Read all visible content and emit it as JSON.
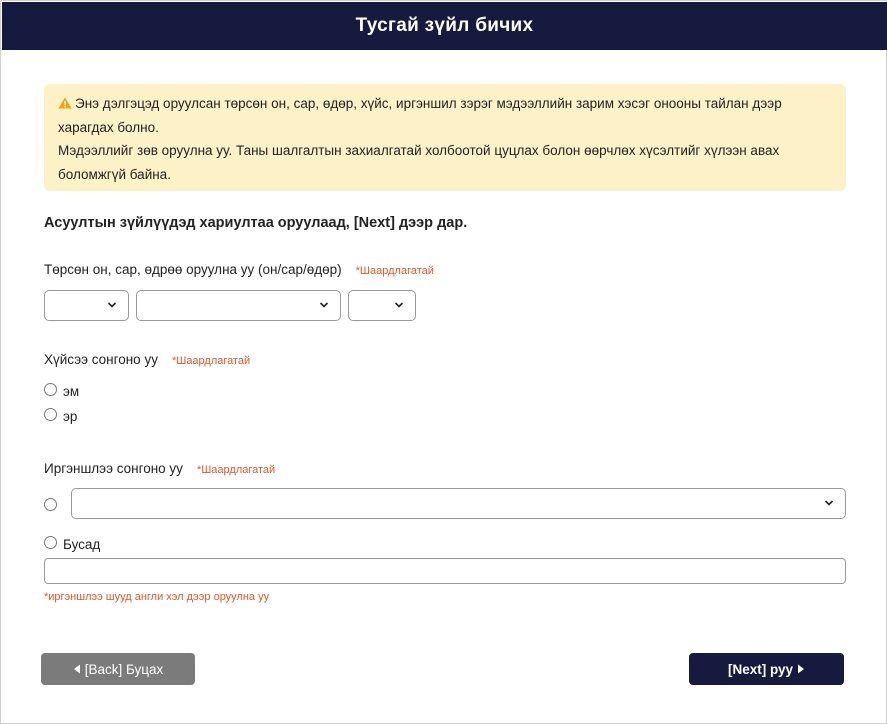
{
  "header": {
    "title": "Тусгай зүйл бичих"
  },
  "notice": {
    "line1": "Энэ дэлгэцэд оруулсан төрсөн он, сар, өдөр, хүйс, иргэншил зэрэг мэдээллийн зарим хэсэг онооны тайлан дээр",
    "line2": "харагдах болно.",
    "line3": "Мэдээллийг зөв оруулна уу. Таны шалгалтын захиалгатай холбоотой цуцлах болон өөрчлөх хүсэлтийг хүлээн авах",
    "line4": "боломжгүй байна.",
    "icon": "warning-icon",
    "icon_color": "#f0a30a",
    "background": "#fdf1c8"
  },
  "instruction": "Асуултын зүйлүүдэд хариултаа оруулаад, [Next] дээр дар.",
  "birthdate": {
    "label": "Төрсөн он, сар, өдрөө оруулна уу (он/сар/өдөр)",
    "required": "*Шаардлагатай",
    "year_value": "",
    "month_value": "",
    "day_value": ""
  },
  "gender": {
    "label": "Хүйсээ сонгоно уу",
    "required": "*Шаардлагатай",
    "options": [
      "эм",
      "эр"
    ]
  },
  "nationality": {
    "label": "Иргэншлээ сонгоно уу",
    "required": "*Шаардлагатай",
    "select_value": "",
    "other_label": "Бусад",
    "other_value": "",
    "hint": "*иргэншлээ шууд англи хэл дээр оруулна уу"
  },
  "buttons": {
    "back_label": "[Back] Буцах",
    "next_label": "[Next] руу"
  },
  "colors": {
    "header": "#161a3e",
    "required": "#e2572a",
    "back_button": "#7b7b7b",
    "next_button": "#161a3e"
  }
}
